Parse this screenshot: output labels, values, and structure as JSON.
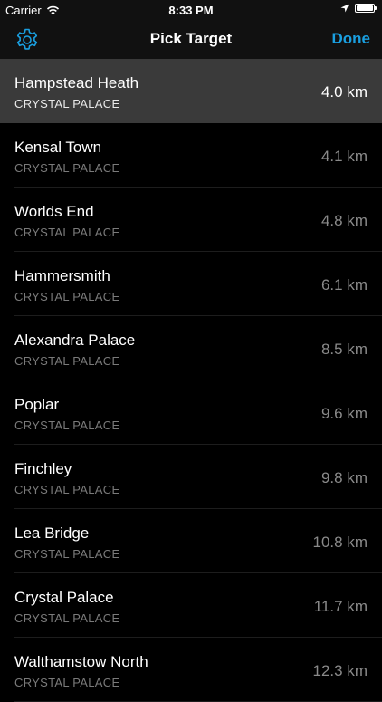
{
  "status_bar": {
    "carrier": "Carrier",
    "time": "8:33 PM",
    "battery_level": 1.0,
    "icons": [
      "wifi-icon",
      "location-arrow-icon",
      "battery-icon"
    ]
  },
  "nav": {
    "title": "Pick Target",
    "done_label": "Done",
    "settings_icon": "gear-icon",
    "accent_color": "#1a9fe0"
  },
  "targets": [
    {
      "name": "Hampstead Heath",
      "area": "CRYSTAL PALACE",
      "distance": "4.0 km",
      "selected": true
    },
    {
      "name": "Kensal Town",
      "area": "CRYSTAL PALACE",
      "distance": "4.1 km",
      "selected": false
    },
    {
      "name": "Worlds End",
      "area": "CRYSTAL PALACE",
      "distance": "4.8 km",
      "selected": false
    },
    {
      "name": "Hammersmith",
      "area": "CRYSTAL PALACE",
      "distance": "6.1 km",
      "selected": false
    },
    {
      "name": "Alexandra Palace",
      "area": "CRYSTAL PALACE",
      "distance": "8.5 km",
      "selected": false
    },
    {
      "name": "Poplar",
      "area": "CRYSTAL PALACE",
      "distance": "9.6 km",
      "selected": false
    },
    {
      "name": "Finchley",
      "area": "CRYSTAL PALACE",
      "distance": "9.8 km",
      "selected": false
    },
    {
      "name": "Lea Bridge",
      "area": "CRYSTAL PALACE",
      "distance": "10.8 km",
      "selected": false
    },
    {
      "name": "Crystal Palace",
      "area": "CRYSTAL PALACE",
      "distance": "11.7 km",
      "selected": false
    },
    {
      "name": "Walthamstow North",
      "area": "CRYSTAL PALACE",
      "distance": "12.3 km",
      "selected": false
    }
  ]
}
